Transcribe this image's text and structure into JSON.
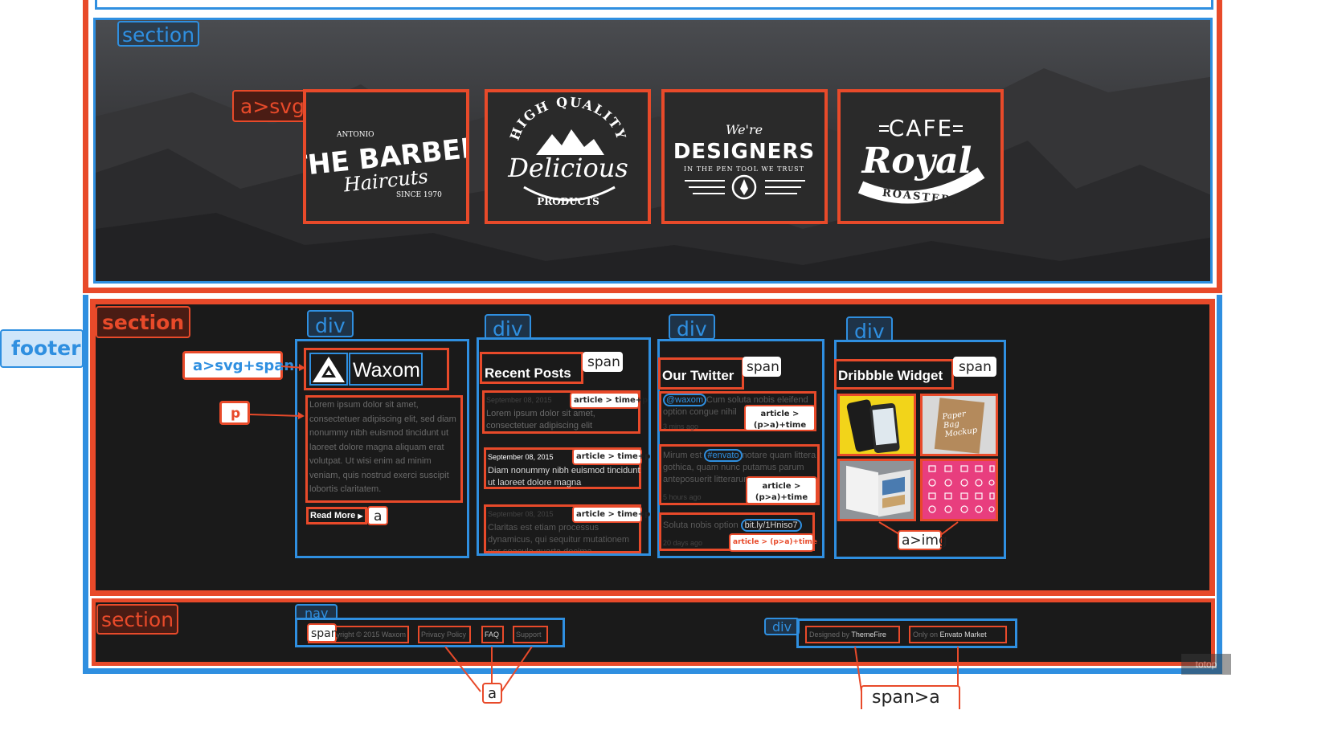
{
  "annotations": {
    "top_section": "section",
    "logo_link": "a>svg",
    "footer": "footer",
    "footer_section": "section",
    "col_div": "div",
    "logo_anno": "a>svg+span",
    "p_anno": "p",
    "span_anno": "span",
    "article_time_p": "article > time+p",
    "article_pa_time": "article >\n(p>a)+time",
    "article_pa_time_inline": "article > (p>a)+time",
    "a_anno": "a",
    "a_img": "a>img",
    "bottom_section": "section",
    "nav_anno": "nav",
    "nav_span": "span",
    "div_anno": "div",
    "a_bottom": "a",
    "span_a_bottom": "span>a"
  },
  "logos": [
    {
      "top": "ANTONIO",
      "main": "THE BARBER",
      "script": "Haircuts",
      "bottom": "SINCE 1970"
    },
    {
      "top": "HIGH QUALITY",
      "main": "Delicious",
      "bottom": "PRODUCTS"
    },
    {
      "top": "We're",
      "main": "DESIGNERS",
      "bottom": "IN THE PEN TOOL WE TRUST"
    },
    {
      "top": "CAFE",
      "main": "Royal",
      "bottom": "ROASTERS"
    }
  ],
  "about": {
    "brand": "Waxom",
    "text": "Lorem ipsum dolor sit amet, consectetuer adipiscing elit, sed diam nonummy nibh euismod tincidunt ut laoreet dolore magna aliquam erat volutpat. Ut wisi enim ad minim veniam, quis nostrud exerci suscipit lobortis claritatem.",
    "read_more": "Read More"
  },
  "recent_posts": {
    "title": "Recent Posts",
    "posts": [
      {
        "date": "September 08, 2015",
        "text": "Lorem ipsum dolor sit amet, consectetuer adipiscing elit"
      },
      {
        "date": "September 08, 2015",
        "text": "Diam nonummy nibh euismod tincidunt ut laoreet dolore magna"
      },
      {
        "date": "September 08, 2015",
        "text": "Claritas est etiam processus dynamicus, qui sequitur mutationem per seacula quarta decima"
      }
    ]
  },
  "twitter": {
    "title": "Our Twitter",
    "tweets": [
      {
        "handle": "@waxom",
        "text": "Cum soluta nobis eleifend option congue nihil",
        "time": "3 mins ago"
      },
      {
        "pre": "Mirum est",
        "handle": "#envato",
        "text": "notare quam littera gothica, quam nunc putamus parum anteposuerit litterarum",
        "time": "5 hours ago"
      },
      {
        "pre": "Soluta nobis option",
        "handle": "bit.ly/1Hniso7",
        "text": "",
        "time": "20 days ago"
      }
    ]
  },
  "dribbble": {
    "title": "Dribbble Widget",
    "thumb_labels": [
      "",
      "Paper Bag Mockup",
      "",
      ""
    ]
  },
  "bottom_bar": {
    "copyright": "Copyright © 2015 Waxom",
    "links": [
      "Privacy Policy",
      "FAQ",
      "Support"
    ],
    "designed_by_pre": "Designed by",
    "designed_by": "ThemeFire",
    "only_on_pre": "Only on",
    "only_on": "Envato Market",
    "totop": "totop"
  },
  "colors": {
    "red": "#e84a2a",
    "blue": "#2f8fe0",
    "footer_bg": "#1a1a1a",
    "pink": "#e83e7e",
    "yellow": "#f2d41a"
  }
}
